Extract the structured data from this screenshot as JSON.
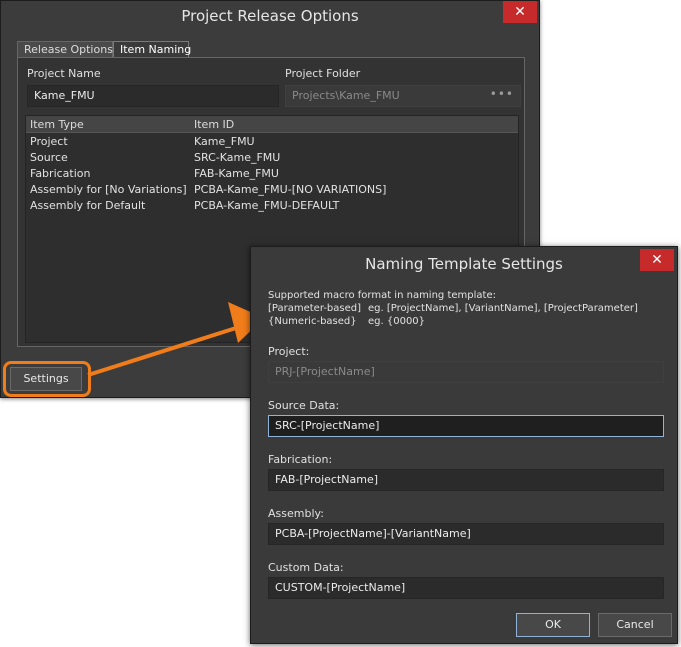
{
  "dialog1": {
    "title": "Project Release Options",
    "close_label": "✕",
    "tabs": [
      {
        "label": "Release Options",
        "active": false
      },
      {
        "label": "Item Naming",
        "active": true
      }
    ],
    "project_name_label": "Project Name",
    "project_name_value": "Kame_FMU",
    "project_folder_label": "Project Folder",
    "project_folder_value": "Projects\\Kame_FMU",
    "project_folder_browse": "•••",
    "grid": {
      "headers": [
        "Item Type",
        "Item ID"
      ],
      "rows": [
        [
          "Project",
          "Kame_FMU"
        ],
        [
          "Source",
          "SRC-Kame_FMU"
        ],
        [
          "Fabrication",
          "FAB-Kame_FMU"
        ],
        [
          "Assembly for [No Variations]",
          "PCBA-Kame_FMU-[NO VARIATIONS]"
        ],
        [
          "Assembly for Default",
          "PCBA-Kame_FMU-DEFAULT"
        ]
      ]
    },
    "settings_button": "Settings"
  },
  "dialog2": {
    "title": "Naming Template Settings",
    "close_label": "✕",
    "info_line1": "Supported macro format in naming template:",
    "info_param_key": "[Parameter-based]",
    "info_param_val": "eg. [ProjectName], [VariantName], [ProjectParameter]",
    "info_num_key": "{Numeric-based}",
    "info_num_val": "eg. {0000}",
    "project_label": "Project:",
    "project_value": "PRJ-[ProjectName]",
    "source_label": "Source Data:",
    "source_value": "SRC-[ProjectName]",
    "fabrication_label": "Fabrication:",
    "fabrication_value": "FAB-[ProjectName]",
    "assembly_label": "Assembly:",
    "assembly_value": "PCBA-[ProjectName]-[VariantName]",
    "custom_label": "Custom Data:",
    "custom_value": "CUSTOM-[ProjectName]",
    "ok_button": "OK",
    "cancel_button": "Cancel"
  },
  "colors": {
    "dialog_bg": "#3c3c3c",
    "close_red": "#c62a2a",
    "callout_orange": "#f07d1a",
    "focus_blue": "#8fb4d8"
  }
}
